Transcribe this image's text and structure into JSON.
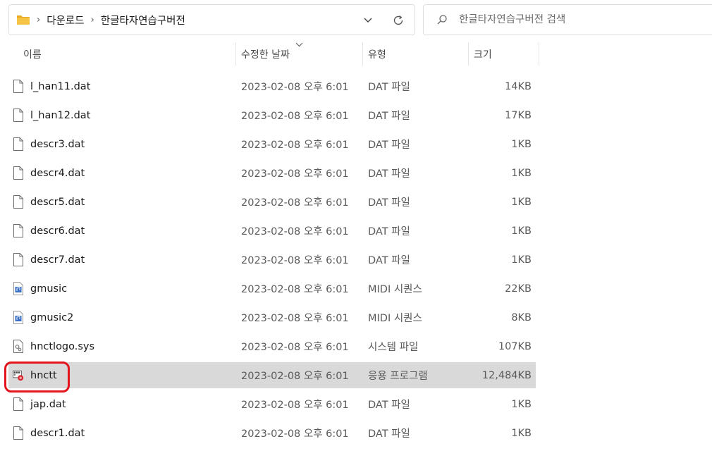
{
  "breadcrumb": {
    "items": [
      "다운로드",
      "한글타자연습구버전"
    ],
    "separator": "›"
  },
  "search": {
    "placeholder": "한글타자연습구버전 검색"
  },
  "columns": {
    "name": "이름",
    "date": "수정한 날짜",
    "type": "유형",
    "size": "크기"
  },
  "files": [
    {
      "name": "l_han11.dat",
      "date": "2023-02-08 오후 6:01",
      "type": "DAT 파일",
      "size": "14KB",
      "icon": "document-icon"
    },
    {
      "name": "l_han12.dat",
      "date": "2023-02-08 오후 6:01",
      "type": "DAT 파일",
      "size": "17KB",
      "icon": "document-icon"
    },
    {
      "name": "descr3.dat",
      "date": "2023-02-08 오후 6:01",
      "type": "DAT 파일",
      "size": "1KB",
      "icon": "document-icon"
    },
    {
      "name": "descr4.dat",
      "date": "2023-02-08 오후 6:01",
      "type": "DAT 파일",
      "size": "1KB",
      "icon": "document-icon"
    },
    {
      "name": "descr5.dat",
      "date": "2023-02-08 오후 6:01",
      "type": "DAT 파일",
      "size": "1KB",
      "icon": "document-icon"
    },
    {
      "name": "descr6.dat",
      "date": "2023-02-08 오후 6:01",
      "type": "DAT 파일",
      "size": "1KB",
      "icon": "document-icon"
    },
    {
      "name": "descr7.dat",
      "date": "2023-02-08 오후 6:01",
      "type": "DAT 파일",
      "size": "1KB",
      "icon": "document-icon"
    },
    {
      "name": "gmusic",
      "date": "2023-02-08 오후 6:01",
      "type": "MIDI 시퀀스",
      "size": "22KB",
      "icon": "midi-file-icon"
    },
    {
      "name": "gmusic2",
      "date": "2023-02-08 오후 6:01",
      "type": "MIDI 시퀀스",
      "size": "8KB",
      "icon": "midi-file-icon"
    },
    {
      "name": "hnctlogo.sys",
      "date": "2023-02-08 오후 6:01",
      "type": "시스템 파일",
      "size": "107KB",
      "icon": "system-file-icon"
    },
    {
      "name": "hnctt",
      "date": "2023-02-08 오후 6:01",
      "type": "응용 프로그램",
      "size": "12,484KB",
      "icon": "application-icon",
      "selected": true
    },
    {
      "name": "jap.dat",
      "date": "2023-02-08 오후 6:01",
      "type": "DAT 파일",
      "size": "1KB",
      "icon": "document-icon"
    },
    {
      "name": "descr1.dat",
      "date": "2023-02-08 오후 6:01",
      "type": "DAT 파일",
      "size": "1KB",
      "icon": "document-icon"
    }
  ],
  "colors": {
    "selected_row": "#d9d9d9",
    "highlight_ring": "#e3141c",
    "folder": "#f4c244"
  }
}
